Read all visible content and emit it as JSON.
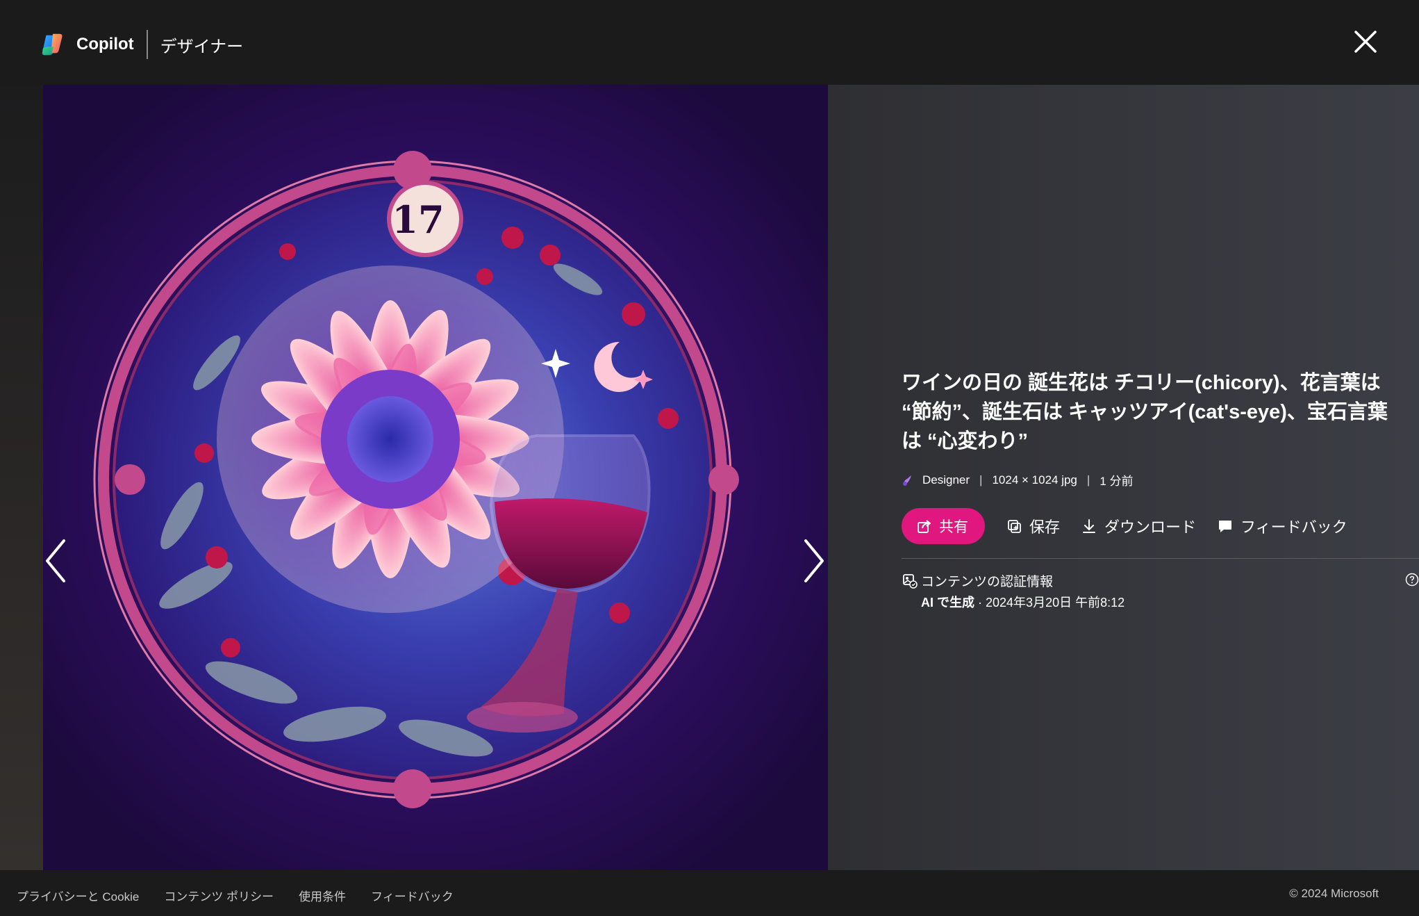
{
  "header": {
    "brand_name": "Copilot",
    "brand_sub": "デザイナー"
  },
  "image": {
    "badge_number": "17"
  },
  "info": {
    "title": "ワインの日の 誕生花は チコリー(chicory)、花言葉は “節約”、誕生石は キャッツアイ(cat's-eye)、宝石言葉は “心変わり”",
    "meta_source": "Designer",
    "meta_size": "1024 × 1024 jpg",
    "meta_time": "1 分前",
    "meta_sep": "|",
    "actions": {
      "share": "共有",
      "save": "保存",
      "download": "ダウンロード",
      "feedback": "フィードバック"
    },
    "credentials": {
      "title": "コンテンツの認証情報",
      "ai_label": "AI で生成",
      "date": " · 2024年3月20日 午前8:12"
    }
  },
  "footer": {
    "links": [
      "プライバシーと Cookie",
      "コンテンツ ポリシー",
      "使用条件",
      "フィードバック"
    ],
    "copyright": "© 2024 Microsoft"
  },
  "colors": {
    "accent": "#e0177f",
    "background": "#1b1b1b"
  }
}
